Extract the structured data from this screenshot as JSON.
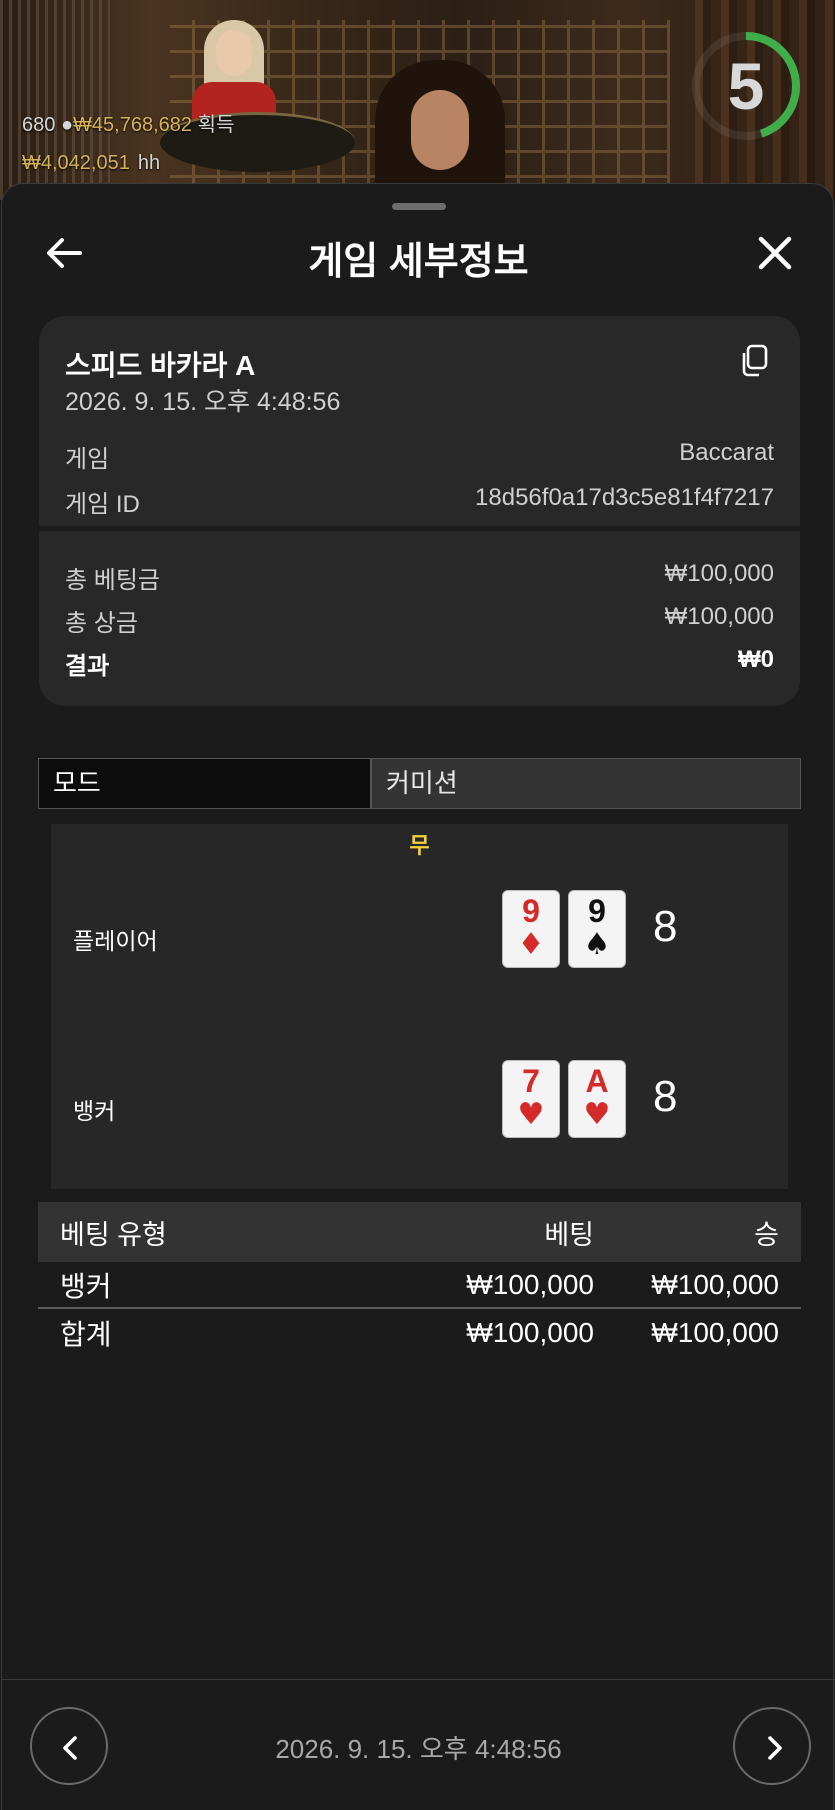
{
  "live": {
    "players": "680",
    "win_amount": "₩45,768,682",
    "win_label": "획득",
    "balance": "₩4,042,051",
    "balance_suffix": "hh",
    "timer": "5",
    "timer_progress": 0.45
  },
  "header": {
    "title": "게임 세부정보",
    "back_icon": "arrow-left-icon",
    "close_icon": "close-icon"
  },
  "summary": {
    "game_name": "스피드 바카라 A",
    "datetime": "2026. 9. 15. 오후 4:48:56",
    "game_label": "게임",
    "game_value": "Baccarat",
    "game_id_label": "게임 ID",
    "game_id_value": "18d56f0a17d3c5e81f4f7217",
    "total_bet_label": "총 베팅금",
    "total_bet_value": "₩100,000",
    "total_prize_label": "총 상금",
    "total_prize_value": "₩100,000",
    "result_label": "결과",
    "result_value": "₩0"
  },
  "tabs": {
    "mode": "모드",
    "commission": "커미션"
  },
  "board": {
    "outcome": "무",
    "player": {
      "label": "플레이어",
      "cards": [
        {
          "rank": "9",
          "suit": "♦",
          "color": "#d42a2a"
        },
        {
          "rank": "9",
          "suit": "♠",
          "color": "#111111"
        }
      ],
      "score": "8"
    },
    "banker": {
      "label": "뱅커",
      "cards": [
        {
          "rank": "7",
          "suit": "♥",
          "color": "#d42a2a"
        },
        {
          "rank": "A",
          "suit": "♥",
          "color": "#d42a2a"
        }
      ],
      "score": "8"
    }
  },
  "bets": {
    "headers": {
      "type": "베팅 유형",
      "bet": "베팅",
      "win": "승"
    },
    "rows": [
      {
        "type": "뱅커",
        "bet": "₩100,000",
        "win": "₩100,000"
      }
    ],
    "total": {
      "label": "합계",
      "bet": "₩100,000",
      "win": "₩100,000"
    }
  },
  "footer": {
    "datetime": "2026. 9. 15. 오후 4:48:56",
    "prev_icon": "chevron-left-icon",
    "next_icon": "chevron-right-icon"
  },
  "colors": {
    "accent_gold": "#d4b25a",
    "timer_green": "#3fae4a",
    "tie_yellow": "#f2d23c",
    "card_red": "#d42a2a"
  }
}
